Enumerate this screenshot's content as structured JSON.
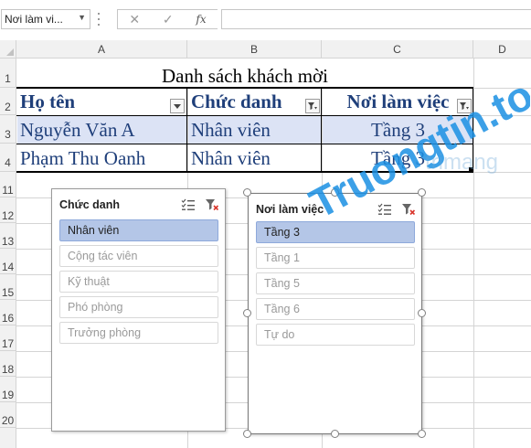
{
  "formula_bar": {
    "name_box": "Nơi làm vi...",
    "cancel_icon": "✕",
    "enter_icon": "✓",
    "function_label": "fx",
    "formula_value": ""
  },
  "columns": [
    "A",
    "B",
    "C",
    "D"
  ],
  "rows": [
    "1",
    "2",
    "3",
    "4",
    "11",
    "12",
    "13",
    "14",
    "15",
    "16",
    "17",
    "18",
    "19",
    "20"
  ],
  "table": {
    "title": "Danh sách khách mời",
    "headers": [
      "Họ tên",
      "Chức danh",
      "Nơi làm việc"
    ],
    "rows": [
      [
        "Nguyễn Văn A",
        "Nhân viên",
        "Tầng 3"
      ],
      [
        "Phạm Thu Oanh",
        "Nhân viên",
        "Tầng 3"
      ]
    ]
  },
  "slicers": [
    {
      "title": "Chức danh",
      "items": [
        {
          "label": "Nhân viên",
          "selected": true
        },
        {
          "label": "Cộng tác viên",
          "selected": false
        },
        {
          "label": "Kỹ thuật",
          "selected": false
        },
        {
          "label": "Phó phòng",
          "selected": false
        },
        {
          "label": "Trưởng phòng",
          "selected": false
        }
      ]
    },
    {
      "title": "Nơi làm việc",
      "items": [
        {
          "label": "Tầng 3",
          "selected": true
        },
        {
          "label": "Tầng 1",
          "selected": false
        },
        {
          "label": "Tầng 5",
          "selected": false
        },
        {
          "label": "Tầng 6",
          "selected": false
        },
        {
          "label": "Tự do",
          "selected": false
        }
      ]
    }
  ],
  "watermark": {
    "text_main": "Truongtin.top",
    "text_faint": "trimang",
    "color": "#1a8fe3"
  },
  "colors": {
    "table_text": "#1f3f7a",
    "band": "#dce3f5",
    "slicer_selected": "#b4c6e7"
  }
}
